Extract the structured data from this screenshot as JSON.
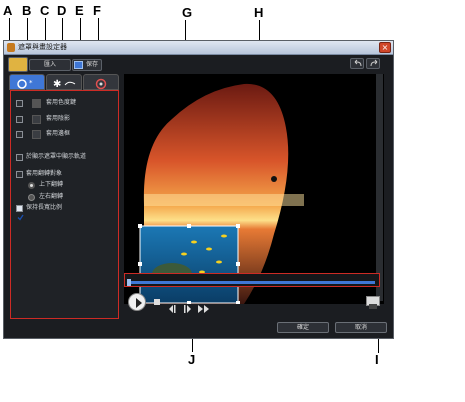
{
  "callouts": {
    "a": "A",
    "b": "B",
    "c": "C",
    "d": "D",
    "e": "E",
    "f": "F",
    "g": "G",
    "h": "H",
    "i": "I",
    "j": "J"
  },
  "window": {
    "title": "遮罩與畫設定器",
    "close_glyph": "×"
  },
  "toolbar": {
    "import_label": "匯入",
    "save_label": "保存"
  },
  "panel": {
    "color_key_label": "套用色度鍵",
    "shadow_label": "套用陰影",
    "border_label": "套用邊框",
    "show_trackers_label": "於顯示遮罩中顯示軌道",
    "flip_label": "套用翻轉對象",
    "flip_vertical_label": "上下翻轉",
    "flip_horizontal_label": "左右翻轉",
    "keep_aspect_label": "保持長寬比例"
  },
  "footer": {
    "ok_label": "確定",
    "cancel_label": "取消"
  },
  "colors": {
    "highlight": "#cc2b25",
    "accent": "#3f77d6"
  }
}
